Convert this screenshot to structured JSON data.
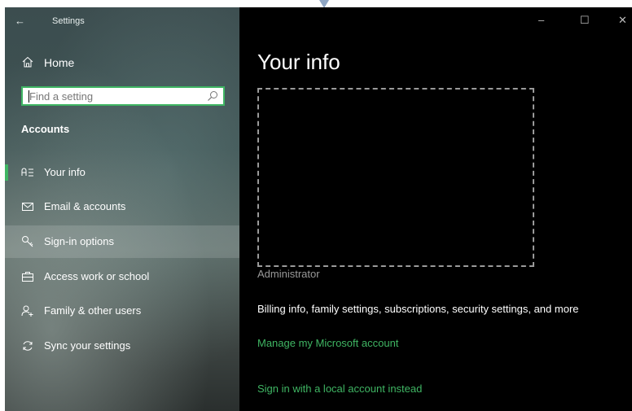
{
  "window": {
    "title": "Settings",
    "back_glyph": "←",
    "controls": {
      "minimize": "–",
      "maximize": "☐",
      "close": "✕"
    }
  },
  "sidebar": {
    "home_label": "Home",
    "search_placeholder": "Find a setting",
    "section_title": "Accounts",
    "items": [
      {
        "label": "Your info",
        "icon": "person-card-icon",
        "active": true
      },
      {
        "label": "Email & accounts",
        "icon": "mail-icon"
      },
      {
        "label": "Sign-in options",
        "icon": "key-icon",
        "hovered": true
      },
      {
        "label": "Access work or school",
        "icon": "briefcase-icon"
      },
      {
        "label": "Family & other users",
        "icon": "add-person-icon"
      },
      {
        "label": "Sync your settings",
        "icon": "sync-icon"
      }
    ]
  },
  "main": {
    "title": "Your info",
    "username": "Administrator",
    "info_text": "Billing info, family settings, subscriptions, security settings, and more",
    "manage_link": "Manage my Microsoft account",
    "local_account_link": "Sign in with a local account instead"
  },
  "colors": {
    "accent": "#3fb563",
    "content_bg": "#000000",
    "sidebar_bg": "#3e5353"
  }
}
